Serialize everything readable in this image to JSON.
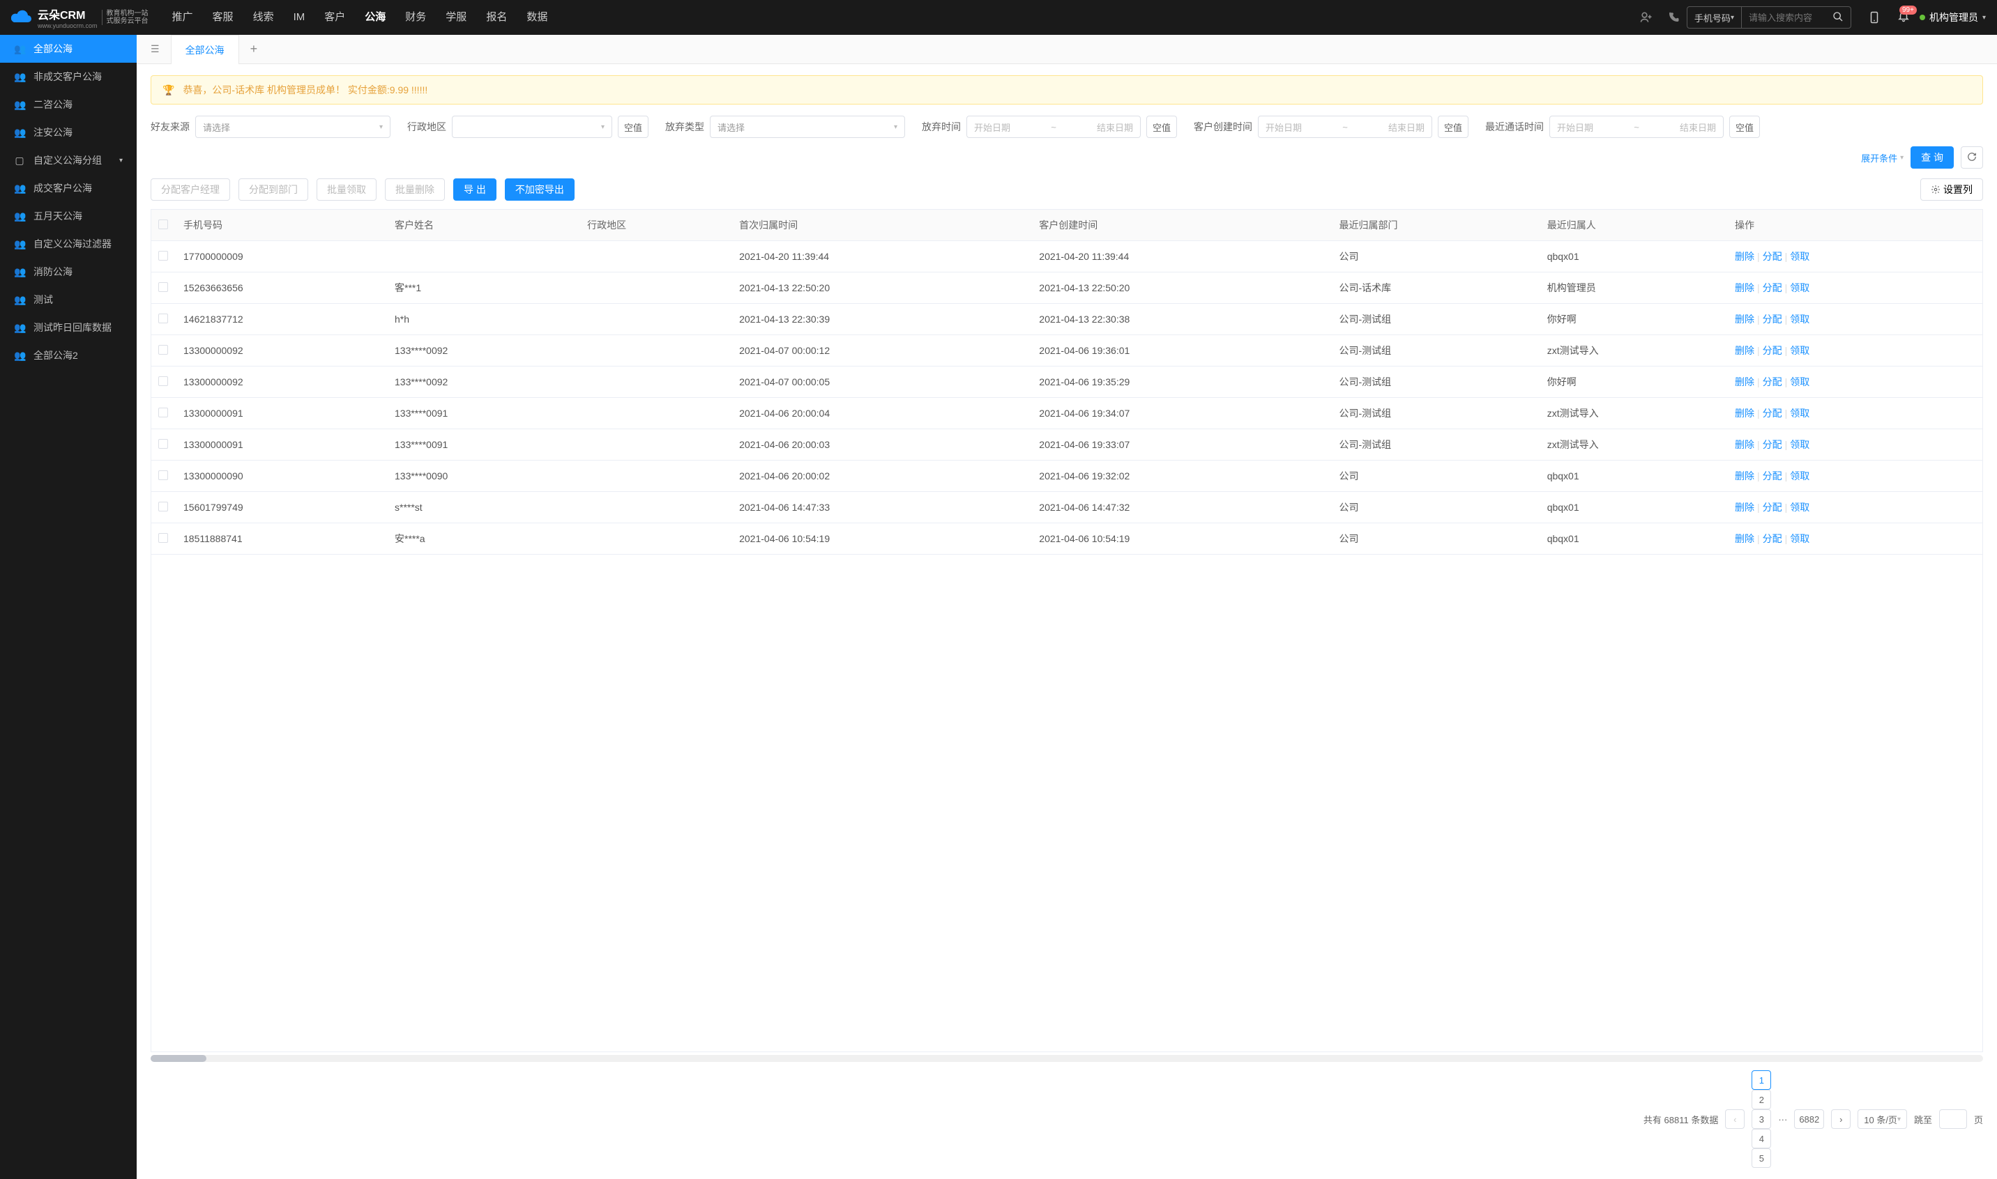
{
  "header": {
    "logo_main": "云朵CRM",
    "logo_url": "www.yunduocrm.com",
    "logo_sub1": "教育机构一站",
    "logo_sub2": "式服务云平台",
    "nav": [
      "推广",
      "客服",
      "线索",
      "IM",
      "客户",
      "公海",
      "财务",
      "学服",
      "报名",
      "数据"
    ],
    "nav_active": 5,
    "search_type": "手机号码",
    "search_placeholder": "请输入搜索内容",
    "badge": "99+",
    "user": "机构管理员"
  },
  "sidebar": [
    {
      "icon": "👥",
      "label": "全部公海",
      "active": true
    },
    {
      "icon": "👥",
      "label": "非成交客户公海"
    },
    {
      "icon": "👥",
      "label": "二咨公海"
    },
    {
      "icon": "👥",
      "label": "注安公海"
    },
    {
      "icon": "▢",
      "label": "自定义公海分组",
      "expand": true
    },
    {
      "icon": "👥",
      "label": "成交客户公海"
    },
    {
      "icon": "👥",
      "label": "五月天公海"
    },
    {
      "icon": "👥",
      "label": "自定义公海过滤器"
    },
    {
      "icon": "👥",
      "label": "消防公海"
    },
    {
      "icon": "👥",
      "label": "测试"
    },
    {
      "icon": "👥",
      "label": "测试昨日回库数据"
    },
    {
      "icon": "👥",
      "label": "全部公海2"
    }
  ],
  "tabs": {
    "active": "全部公海"
  },
  "banner": "恭喜，公司-话术库  机构管理员成单！  实付金额:9.99 !!!!!!",
  "filters": {
    "source_label": "好友来源",
    "source_ph": "请选择",
    "region_label": "行政地区",
    "region_empty": "空值",
    "abandon_type_label": "放弃类型",
    "abandon_type_ph": "请选择",
    "abandon_time_label": "放弃时间",
    "start_ph": "开始日期",
    "end_ph": "结束日期",
    "empty": "空值",
    "create_time_label": "客户创建时间",
    "call_time_label": "最近通话时间",
    "expand": "展开条件",
    "query": "查 询"
  },
  "toolbar": {
    "assign_mgr": "分配客户经理",
    "assign_dept": "分配到部门",
    "batch_claim": "批量领取",
    "batch_del": "批量删除",
    "export": "导 出",
    "export_plain": "不加密导出",
    "set_cols": "设置列"
  },
  "table": {
    "headers": [
      "手机号码",
      "客户姓名",
      "行政地区",
      "首次归属时间",
      "客户创建时间",
      "最近归属部门",
      "最近归属人",
      "操作"
    ],
    "ops": {
      "del": "删除",
      "assign": "分配",
      "claim": "领取"
    },
    "rows": [
      {
        "phone": "17700000009",
        "name": "",
        "region": "",
        "first": "2021-04-20 11:39:44",
        "create": "2021-04-20 11:39:44",
        "dept": "公司",
        "person": "qbqx01"
      },
      {
        "phone": "15263663656",
        "name": "客***1",
        "region": "",
        "first": "2021-04-13 22:50:20",
        "create": "2021-04-13 22:50:20",
        "dept": "公司-话术库",
        "person": "机构管理员"
      },
      {
        "phone": "14621837712",
        "name": "h*h",
        "region": "",
        "first": "2021-04-13 22:30:39",
        "create": "2021-04-13 22:30:38",
        "dept": "公司-测试组",
        "person": "你好啊"
      },
      {
        "phone": "13300000092",
        "name": "133****0092",
        "region": "",
        "first": "2021-04-07 00:00:12",
        "create": "2021-04-06 19:36:01",
        "dept": "公司-测试组",
        "person": "zxt测试导入"
      },
      {
        "phone": "13300000092",
        "name": "133****0092",
        "region": "",
        "first": "2021-04-07 00:00:05",
        "create": "2021-04-06 19:35:29",
        "dept": "公司-测试组",
        "person": "你好啊"
      },
      {
        "phone": "13300000091",
        "name": "133****0091",
        "region": "",
        "first": "2021-04-06 20:00:04",
        "create": "2021-04-06 19:34:07",
        "dept": "公司-测试组",
        "person": "zxt测试导入"
      },
      {
        "phone": "13300000091",
        "name": "133****0091",
        "region": "",
        "first": "2021-04-06 20:00:03",
        "create": "2021-04-06 19:33:07",
        "dept": "公司-测试组",
        "person": "zxt测试导入"
      },
      {
        "phone": "13300000090",
        "name": "133****0090",
        "region": "",
        "first": "2021-04-06 20:00:02",
        "create": "2021-04-06 19:32:02",
        "dept": "公司",
        "person": "qbqx01"
      },
      {
        "phone": "15601799749",
        "name": "s****st",
        "region": "",
        "first": "2021-04-06 14:47:33",
        "create": "2021-04-06 14:47:32",
        "dept": "公司",
        "person": "qbqx01"
      },
      {
        "phone": "18511888741",
        "name": "安****a",
        "region": "",
        "first": "2021-04-06 10:54:19",
        "create": "2021-04-06 10:54:19",
        "dept": "公司",
        "person": "qbqx01"
      }
    ]
  },
  "pagination": {
    "total_prefix": "共有",
    "total": "68811",
    "total_suffix": "条数据",
    "pages": [
      "1",
      "2",
      "3",
      "4",
      "5"
    ],
    "last": "6882",
    "per_page": "10 条/页",
    "goto": "跳至",
    "page_suffix": "页"
  }
}
